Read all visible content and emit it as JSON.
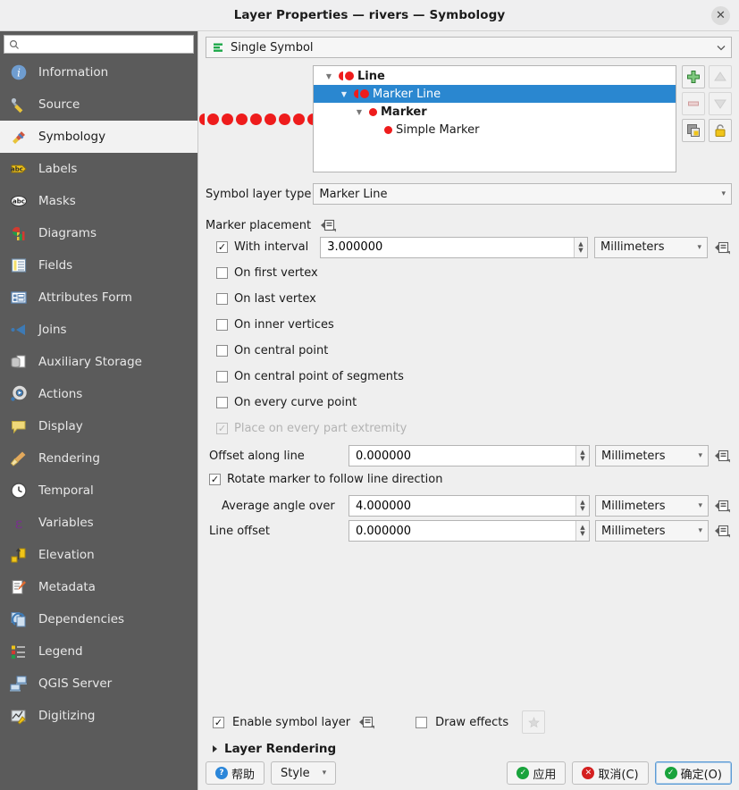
{
  "window": {
    "title": "Layer Properties — rivers — Symbology",
    "close_label": "✕"
  },
  "sidebar": {
    "search": {
      "placeholder": "",
      "value": "",
      "icon": "search-icon"
    },
    "items": [
      {
        "label": "Information",
        "icon": "information-icon",
        "active": false
      },
      {
        "label": "Source",
        "icon": "source-icon",
        "active": false
      },
      {
        "label": "Symbology",
        "icon": "symbology-brush-icon",
        "active": true
      },
      {
        "label": "Labels",
        "icon": "labels-abc-icon",
        "active": false
      },
      {
        "label": "Masks",
        "icon": "masks-abc-icon",
        "active": false
      },
      {
        "label": "Diagrams",
        "icon": "diagrams-icon",
        "active": false
      },
      {
        "label": "Fields",
        "icon": "fields-table-icon",
        "active": false
      },
      {
        "label": "Attributes Form",
        "icon": "attributes-form-icon",
        "active": false
      },
      {
        "label": "Joins",
        "icon": "joins-icon",
        "active": false
      },
      {
        "label": "Auxiliary Storage",
        "icon": "auxiliary-storage-icon",
        "active": false
      },
      {
        "label": "Actions",
        "icon": "actions-gear-icon",
        "active": false
      },
      {
        "label": "Display",
        "icon": "display-balloon-icon",
        "active": false
      },
      {
        "label": "Rendering",
        "icon": "rendering-broom-icon",
        "active": false
      },
      {
        "label": "Temporal",
        "icon": "temporal-clock-icon",
        "active": false
      },
      {
        "label": "Variables",
        "icon": "variables-epsilon-icon",
        "active": false
      },
      {
        "label": "Elevation",
        "icon": "elevation-icon",
        "active": false
      },
      {
        "label": "Metadata",
        "icon": "metadata-pencil-icon",
        "active": false
      },
      {
        "label": "Dependencies",
        "icon": "dependencies-icon",
        "active": false
      },
      {
        "label": "Legend",
        "icon": "legend-icon",
        "active": false
      },
      {
        "label": "QGIS Server",
        "icon": "qgis-server-icon",
        "active": false
      },
      {
        "label": "Digitizing",
        "icon": "digitizing-icon",
        "active": false
      }
    ]
  },
  "renderer": {
    "label": "Single Symbol",
    "icon": "single-symbol-icon"
  },
  "preview": {
    "marker_color": "#ee1c1c",
    "dot_count": 9
  },
  "symbol_tree": {
    "nodes": [
      {
        "label": "Line",
        "indent": 0,
        "bold": true,
        "selected": false,
        "symbol": "line-marker"
      },
      {
        "label": "Marker Line",
        "indent": 1,
        "bold": false,
        "selected": true,
        "symbol": "line-marker"
      },
      {
        "label": "Marker",
        "indent": 2,
        "bold": true,
        "selected": false,
        "symbol": "dot"
      },
      {
        "label": "Simple Marker",
        "indent": 3,
        "bold": false,
        "selected": false,
        "symbol": "dot"
      }
    ],
    "tools": [
      {
        "name": "add-symbol-layer-button",
        "icon": "plus-icon",
        "enabled": true
      },
      {
        "name": "move-up-button",
        "icon": "triangle-up-icon",
        "enabled": false
      },
      {
        "name": "remove-symbol-layer-button",
        "icon": "minus-icon",
        "enabled": false
      },
      {
        "name": "move-down-button",
        "icon": "triangle-down-icon",
        "enabled": false
      },
      {
        "name": "duplicate-symbol-layer-button",
        "icon": "duplicate-icon",
        "enabled": true
      },
      {
        "name": "lock-layer-button",
        "icon": "lock-icon",
        "enabled": true
      }
    ]
  },
  "symbol_layer_type": {
    "label": "Symbol layer type",
    "value": "Marker Line"
  },
  "marker_placement": {
    "label": "Marker placement",
    "options": [
      {
        "label": "With interval",
        "checked": true,
        "disabled": false,
        "has_field": true
      },
      {
        "label": "On first vertex",
        "checked": false,
        "disabled": false,
        "has_field": false
      },
      {
        "label": "On last vertex",
        "checked": false,
        "disabled": false,
        "has_field": false
      },
      {
        "label": "On inner vertices",
        "checked": false,
        "disabled": false,
        "has_field": false
      },
      {
        "label": "On central point",
        "checked": false,
        "disabled": false,
        "has_field": false
      },
      {
        "label": "On central point of segments",
        "checked": false,
        "disabled": false,
        "has_field": false
      },
      {
        "label": "On every curve point",
        "checked": false,
        "disabled": false,
        "has_field": false
      },
      {
        "label": "Place on every part extremity",
        "checked": true,
        "disabled": true,
        "has_field": false
      }
    ],
    "interval": {
      "value": "3.000000",
      "unit": "Millimeters"
    }
  },
  "fields": {
    "offset_along_line": {
      "label": "Offset along line",
      "value": "0.000000",
      "unit": "Millimeters"
    },
    "rotate_marker": {
      "label": "Rotate marker to follow line direction",
      "checked": true
    },
    "average_angle_over": {
      "label": "Average angle over",
      "value": "4.000000",
      "unit": "Millimeters"
    },
    "line_offset": {
      "label": "Line offset",
      "value": "0.000000",
      "unit": "Millimeters"
    }
  },
  "bottom": {
    "enable_symbol_layer": {
      "label": "Enable symbol layer",
      "checked": true
    },
    "draw_effects": {
      "label": "Draw effects",
      "checked": false
    },
    "layer_rendering": "Layer Rendering"
  },
  "buttons": {
    "help": "帮助",
    "style": "Style",
    "apply": "应用",
    "cancel": "取消(C)",
    "ok": "确定(O)"
  }
}
